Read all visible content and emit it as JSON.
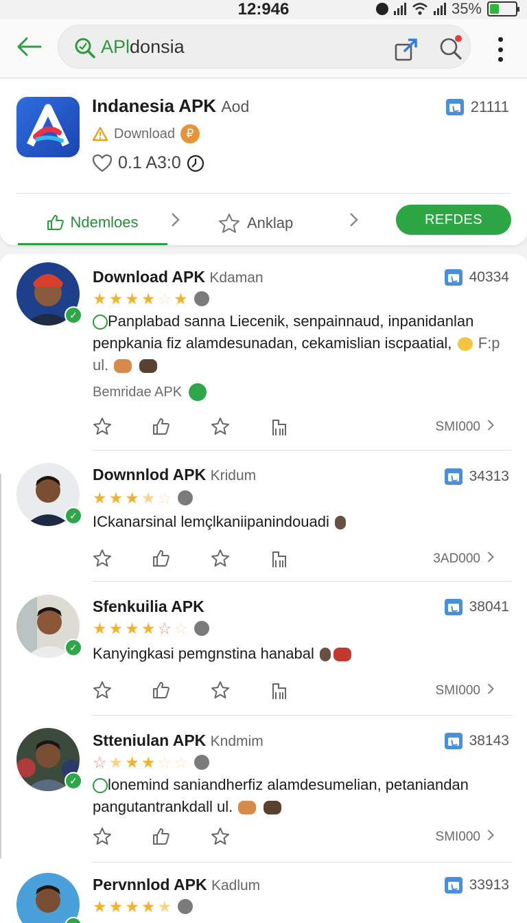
{
  "status_bar": {
    "time": "12:946",
    "battery": "35%",
    "battery_level": 0.35
  },
  "search": {
    "prefix": "APl",
    "rest": "donsia"
  },
  "app": {
    "title": "Indanesia APK",
    "title_suffix": "Aod",
    "download_label": "Download",
    "coin_symbol": "₽",
    "likes": "0.1 A3:0",
    "count": "21111"
  },
  "tabs": {
    "reviews_label": "Ndemloes",
    "ranking_label": "Anklap",
    "action_button": "REFDES"
  },
  "colors": {
    "accent": "#2ca744",
    "star": "#f4b22a",
    "link_blue": "#4a90d9"
  },
  "reviews": [
    {
      "name": "Download APK",
      "name_suffix": "Kdaman",
      "count": "40334",
      "stars": [
        "full",
        "full",
        "full",
        "full",
        "empty",
        "full"
      ],
      "text": "Panplabad sanna Liecenik, senpainnaud, inpanidanlan penpkania fiz alamdesunadan, cekamislian iscpaatial,",
      "text_tail": "F:p ul.",
      "source": "Bemridae APK",
      "action_label": "SMI000"
    },
    {
      "name": "Downnlod APK",
      "name_suffix": "Kridum",
      "count": "34313",
      "stars": [
        "full",
        "full",
        "full",
        "half",
        "empty"
      ],
      "text": "ICkanarsinal lemçlkaniipanindouadi",
      "action_label": "3AD000"
    },
    {
      "name": "Sfenkuilia APK",
      "name_suffix": "",
      "count": "38041",
      "stars": [
        "full",
        "full",
        "full",
        "full",
        "red",
        "empty"
      ],
      "text": "Kanyingkasi pemgnstina hanabal",
      "action_label": "SMI000"
    },
    {
      "name": "Stteniulan APK",
      "name_suffix": "Kndmim",
      "count": "38143",
      "stars": [
        "red",
        "half",
        "full",
        "full",
        "empty",
        "empty"
      ],
      "text": "lonemind saniandherfiz alamdesumelian, petaniandan pangutantrankdall ul.",
      "action_label": "SMI000"
    },
    {
      "name": "Pervnnlod APK",
      "name_suffix": "Kadlum",
      "count": "33913",
      "stars": [
        "full",
        "full",
        "full",
        "full",
        "half"
      ]
    }
  ]
}
